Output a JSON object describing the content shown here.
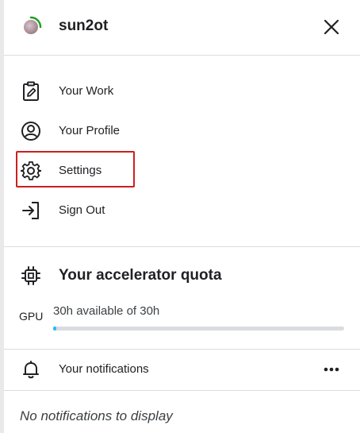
{
  "header": {
    "username": "sun2ot"
  },
  "menu": {
    "items": [
      {
        "label": "Your Work",
        "icon": "clipboard-edit-icon"
      },
      {
        "label": "Your Profile",
        "icon": "profile-icon"
      },
      {
        "label": "Settings",
        "icon": "gear-icon"
      },
      {
        "label": "Sign Out",
        "icon": "sign-out-icon"
      }
    ]
  },
  "quota": {
    "title": "Your accelerator quota",
    "gpu": {
      "label": "GPU",
      "text": "30h available of 30h",
      "used_fraction": 0.0
    }
  },
  "notifications": {
    "label": "Your notifications",
    "empty_text": "No notifications to display"
  },
  "colors": {
    "highlight_border": "#cc1f1f",
    "progress": "#20beff",
    "avatar_ring": "#20a020"
  }
}
